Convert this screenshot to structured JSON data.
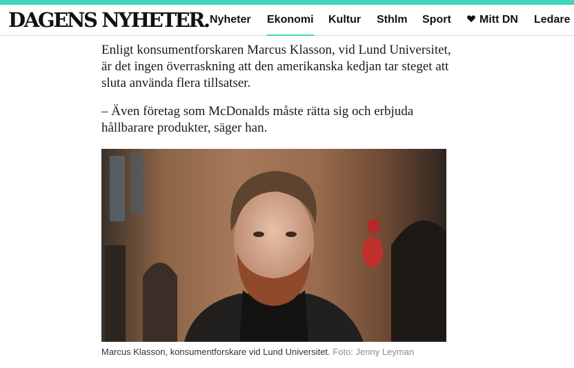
{
  "header": {
    "logo": "DAGENS NYHETER.",
    "nav": [
      {
        "label": "Nyheter",
        "active": false
      },
      {
        "label": "Ekonomi",
        "active": true
      },
      {
        "label": "Kultur",
        "active": false
      },
      {
        "label": "Sthlm",
        "active": false
      },
      {
        "label": "Sport",
        "active": false
      },
      {
        "label": "Mitt DN",
        "active": false,
        "icon": "heart-icon"
      },
      {
        "label": "Ledare",
        "active": false
      }
    ]
  },
  "article": {
    "paragraphs": [
      "Enligt konsumentforskaren Marcus Klasson, vid Lund Universitet, är det ingen överraskning att den amerikanska kedjan tar steget att sluta använda flera tillsatser.",
      "– Även företag som McDonalds måste rätta sig och erbjuda hållbarare produkter, säger han."
    ],
    "image": {
      "caption": "Marcus Klasson, konsumentforskare vid Lund Universitet.",
      "credit": "Foto: Jenny Leyman"
    }
  },
  "colors": {
    "accent": "#3fd6b9",
    "text": "#1a1a1a",
    "credit": "#8a8a8a"
  }
}
